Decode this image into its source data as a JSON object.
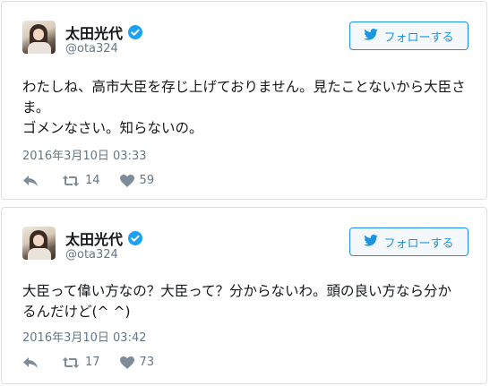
{
  "tweets": [
    {
      "name": "太田光代",
      "handle": "@ota324",
      "follow_label": "フォローする",
      "text_lines": [
        "わたしね、高市大臣を存じ上げておりません。見たことないから大臣さ",
        "ま。",
        "ゴメンなさい。知らないの。"
      ],
      "timestamp": "2016年3月10日 03:33",
      "retweets": "14",
      "likes": "59"
    },
    {
      "name": "太田光代",
      "handle": "@ota324",
      "follow_label": "フォローする",
      "text_lines": [
        "大臣って偉い方なの？大臣って？分からないわ。頭の良い方なら分か",
        "るんだけど(^ ^)"
      ],
      "timestamp": "2016年3月10日 03:42",
      "retweets": "17",
      "likes": "73"
    }
  ],
  "colors": {
    "accent": "#1b95e0",
    "verified": "#1da1f2",
    "muted": "#657786",
    "text": "#14171a",
    "border": "#dcdfe2"
  },
  "icons": [
    "verified-badge-icon",
    "twitter-bird-icon",
    "reply-icon",
    "retweet-icon",
    "heart-icon"
  ]
}
